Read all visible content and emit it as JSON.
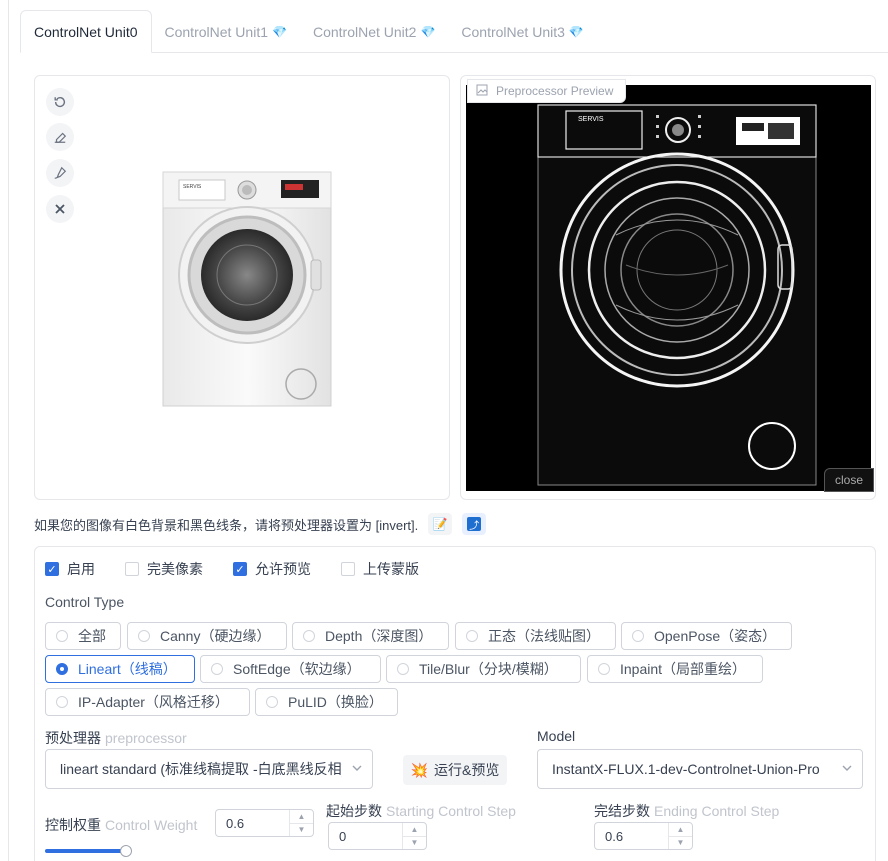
{
  "tabs": [
    {
      "label": "ControlNet Unit0",
      "active": true
    },
    {
      "label": "ControlNet Unit1",
      "active": false
    },
    {
      "label": "ControlNet Unit2",
      "active": false
    },
    {
      "label": "ControlNet Unit3",
      "active": false
    }
  ],
  "preview": {
    "label": "Preprocessor Preview",
    "close": "close"
  },
  "washer": {
    "brand": "SERVIS"
  },
  "hint": {
    "text": "如果您的图像有白色背景和黑色线条，请将预处理器设置为 [invert]."
  },
  "checks": [
    {
      "label": "启用",
      "checked": true
    },
    {
      "label": "完美像素",
      "checked": false
    },
    {
      "label": "允许预览",
      "checked": true
    },
    {
      "label": "上传蒙版",
      "checked": false
    }
  ],
  "control_type": {
    "label": "Control Type",
    "options": [
      "全部",
      "Canny（硬边缘）",
      "Depth（深度图）",
      "正态（法线贴图）",
      "OpenPose（姿态）",
      "Lineart（线稿）",
      "SoftEdge（软边缘）",
      "Tile/Blur（分块/模糊）",
      "Inpaint（局部重绘）",
      "IP-Adapter（风格迁移）",
      "PuLID（换脸）"
    ],
    "selected": "Lineart（线稿）"
  },
  "preprocessor": {
    "label": "预处理器",
    "sub": "preprocessor",
    "value": "lineart standard (标准线稿提取 -白底黑线反相)"
  },
  "run_button": {
    "icon": "💥",
    "label": "运行&预览"
  },
  "model": {
    "label": "Model",
    "value": "InstantX-FLUX.1-dev-Controlnet-Union-Pro"
  },
  "weight": {
    "label": "控制权重",
    "sub": "Control Weight",
    "value": "0.6"
  },
  "start_step": {
    "label": "起始步数",
    "sub": "Starting Control Step",
    "value": "0"
  },
  "end_step": {
    "label": "完结步数",
    "sub": "Ending Control Step",
    "value": "0.6"
  }
}
